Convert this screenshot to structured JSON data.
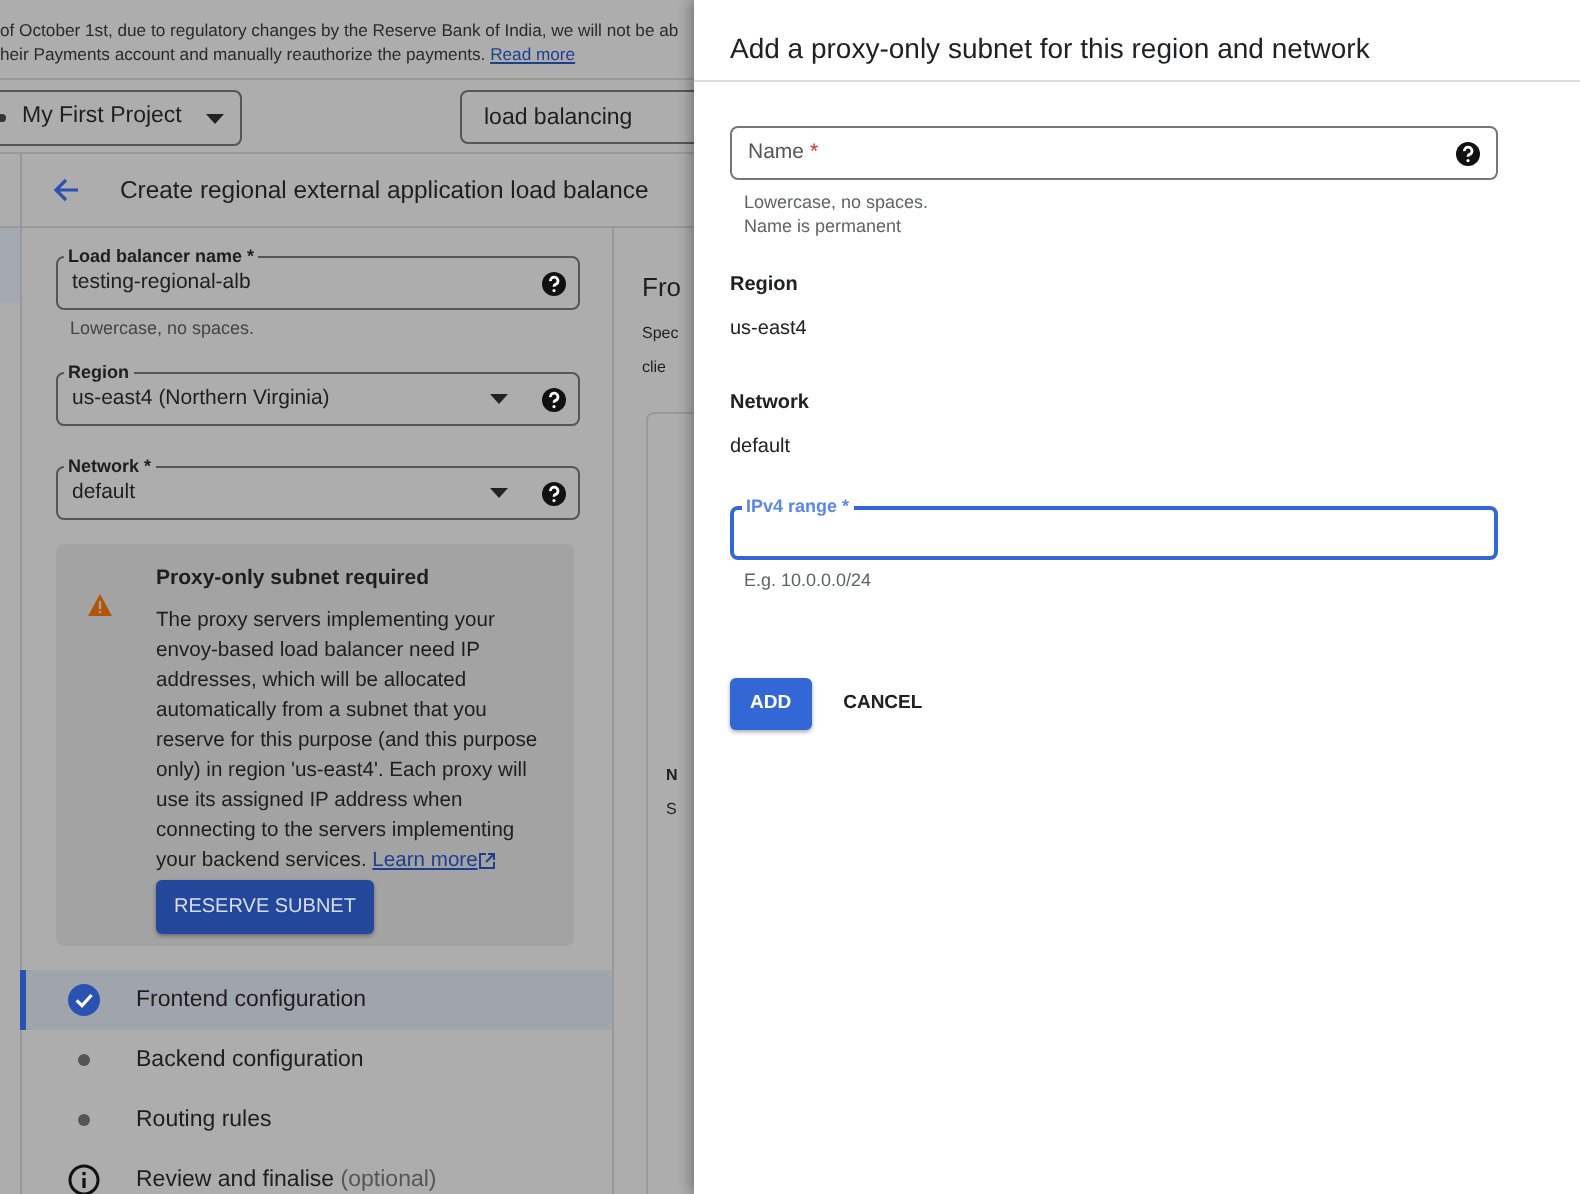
{
  "banner": {
    "line_1": "of October 1st, due to regulatory changes by the Reserve Bank of India, we will not be ab",
    "line_2": "heir Payments account and manually reauthorize the payments.",
    "link": "Read more"
  },
  "toolbar": {
    "project": "My First Project",
    "search": "load balancing"
  },
  "header": {
    "title": "Create regional external application load balance"
  },
  "form": {
    "fields": [
      {
        "kind": "text",
        "label": "Load balancer name",
        "required_mark": "*",
        "value": "testing-regional-alb",
        "helper": "Lowercase, no spaces."
      },
      {
        "kind": "select",
        "label": "Region",
        "value": "us-east4 (Northern Virginia)"
      },
      {
        "kind": "select",
        "label": "Network",
        "required_mark": "*",
        "value": "default"
      }
    ],
    "alert": {
      "title": "Proxy-only subnet required",
      "body": "The proxy servers implementing your envoy-based load balancer need IP addresses, which will be allocated automatically from a subnet that you reserve for this purpose (and this purpose only) in region 'us-east4'. Each proxy will use its assigned IP address when connecting to the servers implementing your backend services.",
      "link": "Learn more",
      "button": "RESERVE SUBNET"
    }
  },
  "steps": [
    {
      "label": "Frontend configuration",
      "kind": "done",
      "selected": true
    },
    {
      "label": "Backend configuration",
      "kind": "pending",
      "selected": false
    },
    {
      "label": "Routing rules",
      "kind": "pending",
      "selected": false
    },
    {
      "label": "Review and finalise",
      "suffix": "(optional)",
      "kind": "info",
      "selected": false
    }
  ],
  "right_column": {
    "heading": "Fro",
    "lines": [
      "Spec",
      "clie"
    ],
    "label": "N",
    "text": "S"
  },
  "panel": {
    "title": "Add a proxy-only subnet for this region and network",
    "name_field": {
      "label": "Name",
      "required_mark": "*",
      "helpers": [
        "Lowercase, no spaces.",
        "Name is permanent"
      ]
    },
    "info": [
      {
        "label": "Region",
        "value": "us-east4"
      },
      {
        "label": "Network",
        "value": "default"
      }
    ],
    "range_field": {
      "label": "IPv4 range",
      "required_mark": "*",
      "focused": true,
      "helper": "E.g. 10.0.0.0/24"
    },
    "buttons": [
      {
        "label": "ADD",
        "kind": "primary"
      },
      {
        "label": "CANCEL",
        "kind": "text"
      }
    ]
  }
}
